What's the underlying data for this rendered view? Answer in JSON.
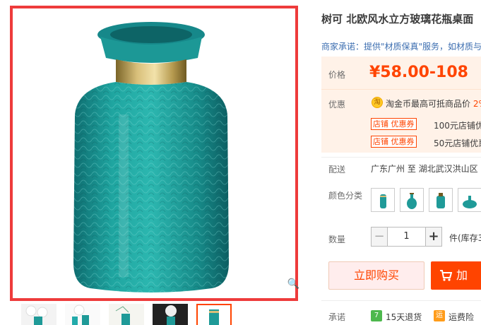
{
  "product": {
    "title": "树可 北欧风水立方玻璃花瓶桌面",
    "merchant_promise": "商家承诺：提供\"材质保真\"服务，如材质与"
  },
  "price": {
    "label": "价格",
    "value": "¥58.00-108"
  },
  "promo": {
    "label": "优惠",
    "coin_icon_char": "淘",
    "coin_text": "淘金币最高可抵商品价 ",
    "coin_pct": "2%",
    "coupons": [
      {
        "tag": "店铺 优惠券",
        "text": "100元店铺优"
      },
      {
        "tag": "店铺 优惠券",
        "text": "50元店铺优惠"
      }
    ]
  },
  "shipping": {
    "label": "配送",
    "text": "广东广州 至  湖北武汉洪山区"
  },
  "color": {
    "label": "颜色分类"
  },
  "quantity": {
    "label": "数量",
    "value": "1",
    "minus": "−",
    "plus": "+",
    "unit": "件(库存3"
  },
  "buttons": {
    "buy_now": "立即购买",
    "add_cart": "加"
  },
  "promise": {
    "label": "承诺",
    "items": [
      {
        "badge": "7",
        "text": "15天退货"
      },
      {
        "badge": "运",
        "text": "运费险"
      }
    ]
  },
  "colors": {
    "accent": "#ff4400",
    "vase_teal": "#1f9a98",
    "gallery_border": "#ee3b3b",
    "price_bg": "#fff2e8"
  }
}
